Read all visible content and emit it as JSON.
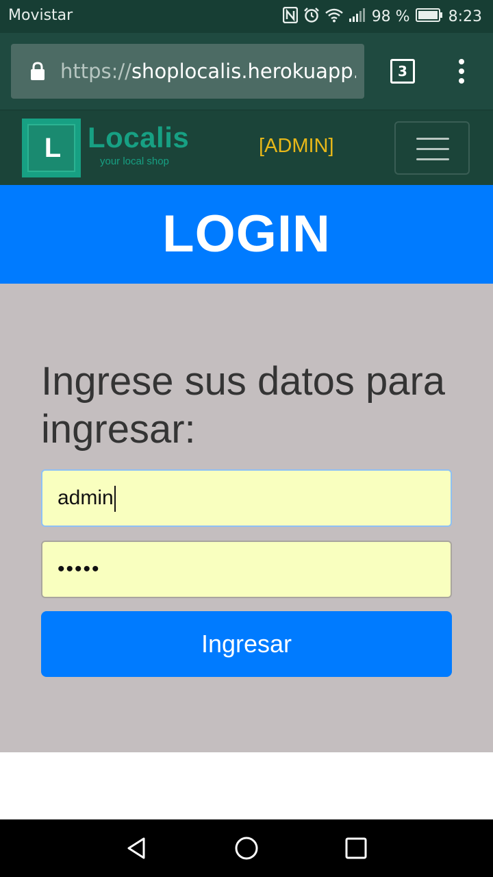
{
  "status_bar": {
    "carrier": "Movistar",
    "battery": "98 %",
    "time": "8:23",
    "icons": [
      "nfc-icon",
      "alarm-icon",
      "wifi-icon",
      "signal-icon",
      "battery-icon"
    ]
  },
  "browser": {
    "url_scheme": "https://",
    "url_host": "shoplocalis.herokuapp.",
    "tab_count": "3",
    "icons": [
      "lock-icon",
      "tabs-icon",
      "more-vert-icon"
    ]
  },
  "navbar": {
    "logo_letter": "L",
    "logo_name": "Localis",
    "logo_tagline": "your local shop",
    "role_label": "[ADMIN]",
    "toggle_icon": "hamburger-icon"
  },
  "banner": {
    "title": "LOGIN"
  },
  "form": {
    "heading": "Ingrese sus datos para ingresar:",
    "username_value": "admin",
    "password_value": "•••••",
    "submit_label": "Ingresar"
  },
  "colors": {
    "accent": "#007bff",
    "navbar": "#1b4439",
    "brand": "#17a083",
    "admin": "#e8b819",
    "input_bg": "#f9ffbf",
    "section_bg": "#c4bebf"
  },
  "system_nav": {
    "icons": [
      "back-icon",
      "home-icon",
      "recents-icon"
    ]
  }
}
